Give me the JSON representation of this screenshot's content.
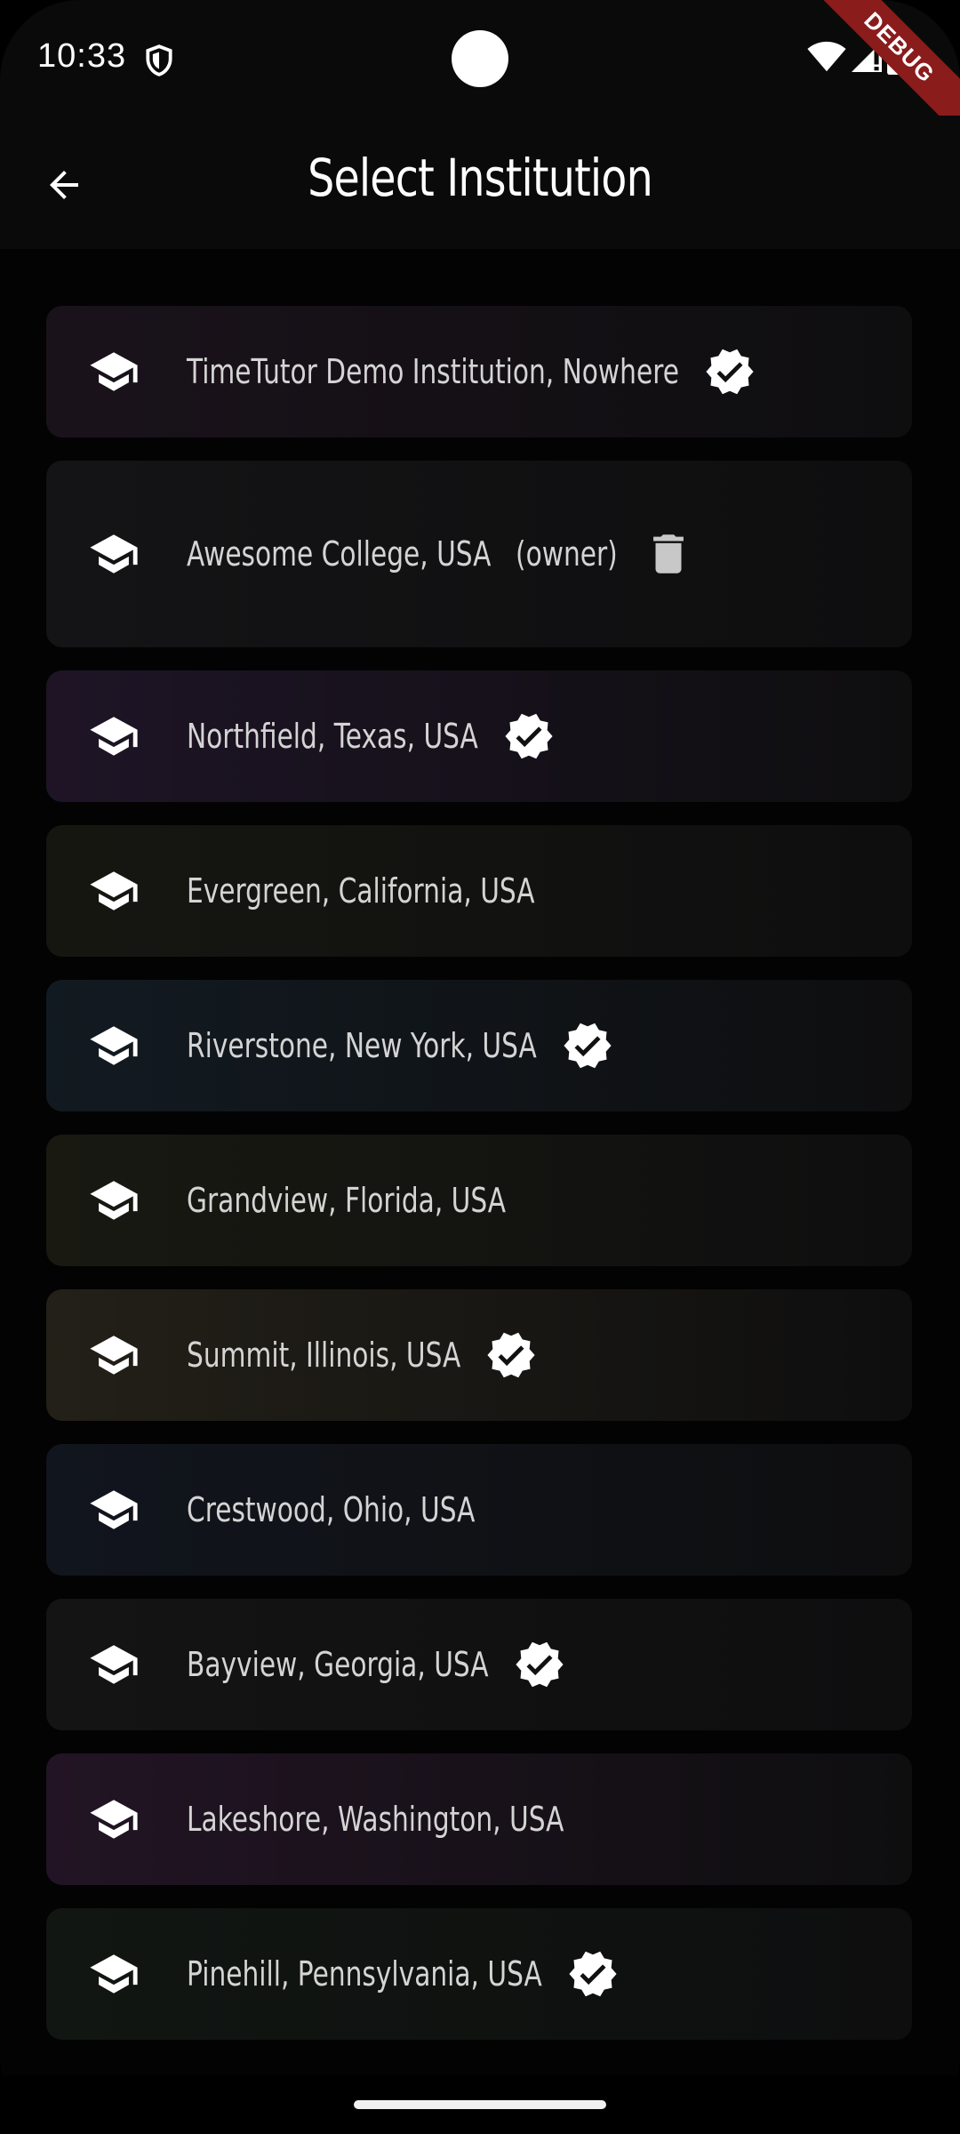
{
  "status_bar": {
    "time": "10:33",
    "debug_label": "DEBUG"
  },
  "app_bar": {
    "title": "Select Institution"
  },
  "institutions": [
    {
      "name": "TimeTutor Demo Institution, Nowhere",
      "verified": true,
      "owner_label": "",
      "color": "#1a121b"
    },
    {
      "name": "Awesome College, USA",
      "verified": false,
      "owner_label": "(owner)",
      "deletable": true,
      "color": "#141416"
    },
    {
      "name": "Northfield, Texas, USA",
      "verified": true,
      "owner_label": "",
      "color": "#1e1426"
    },
    {
      "name": "Evergreen, California, USA",
      "verified": false,
      "owner_label": "",
      "color": "#161611"
    },
    {
      "name": "Riverstone, New York, USA",
      "verified": true,
      "owner_label": "",
      "color": "#121a21"
    },
    {
      "name": "Grandview, Florida, USA",
      "verified": false,
      "owner_label": "",
      "color": "#191912"
    },
    {
      "name": "Summit, Illinois, USA",
      "verified": true,
      "owner_label": "",
      "color": "#232018"
    },
    {
      "name": "Crestwood, Ohio, USA",
      "verified": false,
      "owner_label": "",
      "color": "#11151d"
    },
    {
      "name": "Bayview, Georgia, USA",
      "verified": true,
      "owner_label": "",
      "color": "#151414"
    },
    {
      "name": "Lakeshore, Washington, USA",
      "verified": false,
      "owner_label": "",
      "color": "#221424"
    },
    {
      "name": "Pinehill, Pennsylvania, USA",
      "verified": true,
      "owner_label": "",
      "color": "#111612"
    }
  ]
}
